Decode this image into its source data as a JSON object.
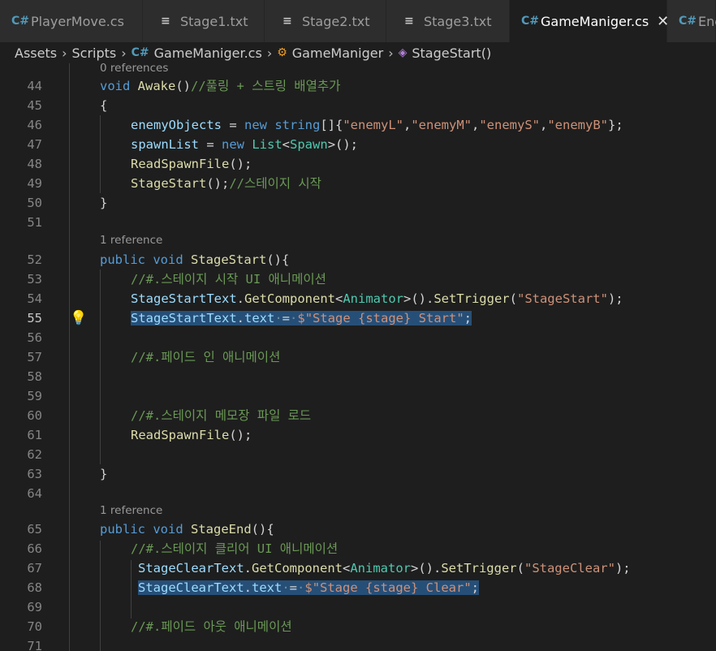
{
  "tabs": [
    {
      "label": "PlayerMove.cs",
      "icon": "csharp-icon"
    },
    {
      "label": "Stage1.txt",
      "icon": "text-file-icon"
    },
    {
      "label": "Stage2.txt",
      "icon": "text-file-icon"
    },
    {
      "label": "Stage3.txt",
      "icon": "text-file-icon"
    },
    {
      "label": "GameManiger.cs",
      "icon": "csharp-icon",
      "active": true
    },
    {
      "label": "Ene",
      "icon": "csharp-icon"
    }
  ],
  "breadcrumb": {
    "assets": "Assets",
    "scripts": "Scripts",
    "file": "GameManiger.cs",
    "class": "GameManiger",
    "method": "StageStart()"
  },
  "lens": {
    "awake": "0 references",
    "stage_start": "1 reference",
    "stage_end": "1 reference"
  },
  "line_numbers": [
    "44",
    "45",
    "46",
    "47",
    "48",
    "49",
    "50",
    "51",
    "52",
    "53",
    "54",
    "55",
    "56",
    "57",
    "58",
    "59",
    "60",
    "61",
    "62",
    "63",
    "64",
    "65",
    "66",
    "67",
    "68",
    "69",
    "70",
    "71"
  ],
  "code": {
    "l44_comment": "//풀링 + 스트링 배열추가",
    "l46_s1": "\"enemyL\"",
    "l46_s2": "\"enemyM\"",
    "l46_s3": "\"enemyS\"",
    "l46_s4": "\"enemyB\"",
    "l49_comment": "//스테이지 시작",
    "l53_comment": "//#.스테이지 시작 UI 애니메이션",
    "l54_arg": "\"StageStart\"",
    "l55_str": "$\"Stage {stage} Start\"",
    "l57_comment": "//#.페이드 인 애니메이션",
    "l60_comment": "//#.스테이지 메모장 파일 로드",
    "l66_comment": "//#.스테이지 클리어 UI 애니메이션",
    "l67_arg": "\"StageClear\"",
    "l68_str": "$\"Stage {stage} Clear\"",
    "l70_comment": "//#.페이드 아웃 애니메이션"
  },
  "colors": {
    "background": "#1e1e1e",
    "keyword": "#569cd6",
    "type": "#4ec9b0",
    "function": "#dcdcaa",
    "variable": "#9cdcfe",
    "string": "#ce9178",
    "comment": "#6a9955",
    "selection": "#264f78"
  }
}
